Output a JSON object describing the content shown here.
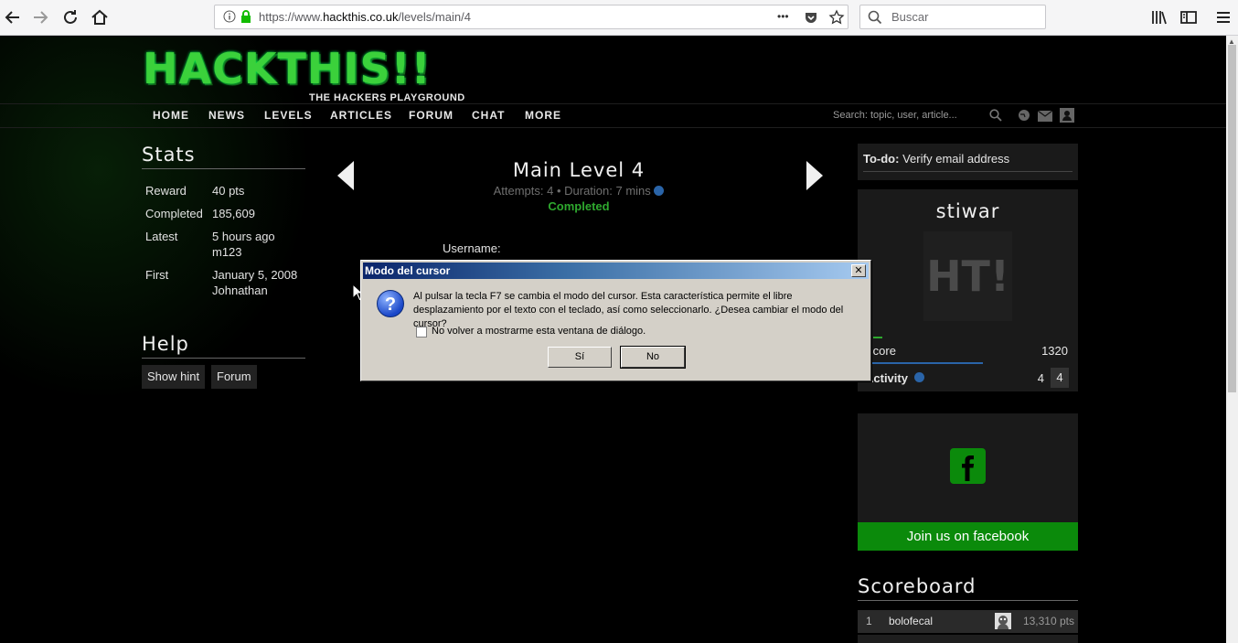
{
  "browser": {
    "url_prefix": "https://www.",
    "url_domain": "hackthis.co.uk",
    "url_path": "/levels/main/4",
    "search_placeholder": "Buscar",
    "more_glyph": "•••"
  },
  "site": {
    "logo_title": "HACKTHIS!!",
    "logo_subtitle": "THE HACKERS PLAYGROUND",
    "nav": [
      "HOME",
      "NEWS",
      "LEVELS",
      "ARTICLES",
      "FORUM",
      "CHAT",
      "MORE"
    ],
    "search_placeholder": "Search: topic, user, article..."
  },
  "stats": {
    "heading": "Stats",
    "rows": [
      {
        "label": "Reward",
        "value": "40 pts",
        "sub": ""
      },
      {
        "label": "Completed",
        "value": "185,609",
        "sub": ""
      },
      {
        "label": "Latest",
        "value": "5 hours ago",
        "sub": "m123"
      },
      {
        "label": "First",
        "value": "January 5, 2008",
        "sub": "Johnathan"
      }
    ]
  },
  "help": {
    "heading": "Help",
    "hint_label": "Show hint",
    "forum_label": "Forum"
  },
  "level": {
    "title": "Main Level 4",
    "meta": "Attempts: 4 • Duration: 7 mins",
    "status": "Completed",
    "username_label": "Username:"
  },
  "sidebar": {
    "todo_prefix": "To-do:",
    "todo_text": "Verify email address",
    "username": "stiwar",
    "avatar_text": "HT!",
    "score_label": "Score",
    "score_value": "1320",
    "activity_label": "Activity",
    "activity_value": "4",
    "activity_badge": "4",
    "fb_label": "Join us on facebook",
    "scoreboard_heading": "Scoreboard",
    "scoreboard": [
      {
        "rank": "1",
        "name": "bolofecal",
        "points": "13,310 pts"
      }
    ]
  },
  "dialog": {
    "title": "Modo del cursor",
    "message": "Al pulsar la tecla F7 se cambia el modo del cursor. Esta característica permite el libre desplazamiento por el texto con el teclado, así como seleccionarlo. ¿Desea cambiar el modo del cursor?",
    "checkbox_label": "No volver a mostrarme esta ventana de diálogo.",
    "yes_label": "Sí",
    "no_label": "No",
    "close_glyph": "✕"
  }
}
